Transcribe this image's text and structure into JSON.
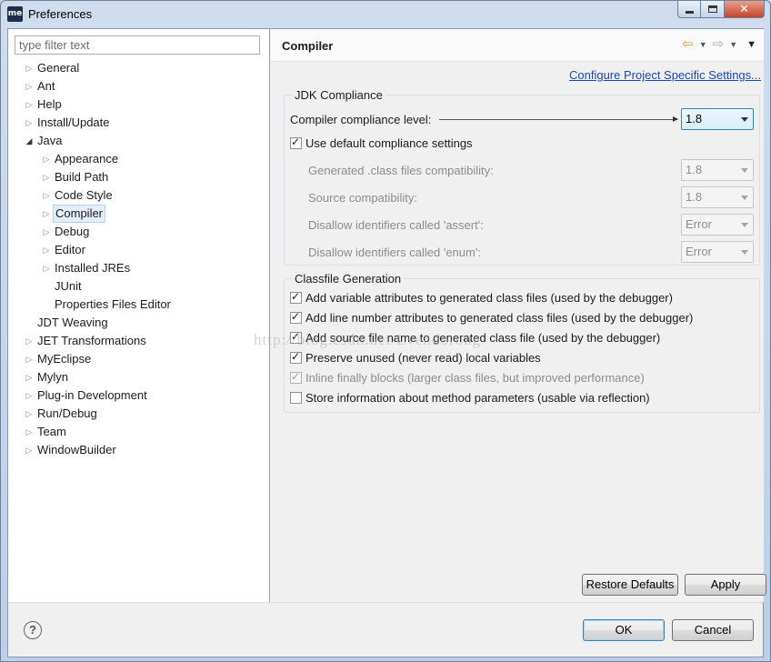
{
  "window": {
    "title": "Preferences",
    "app_icon": "me",
    "controls": {
      "minimize": "minimize-icon",
      "maximize": "maximize-icon",
      "close": "✕"
    }
  },
  "filter": {
    "placeholder": "type filter text",
    "value": ""
  },
  "tree": {
    "items": [
      {
        "label": "General",
        "level": 0,
        "expandable": true,
        "expanded": false
      },
      {
        "label": "Ant",
        "level": 0,
        "expandable": true,
        "expanded": false
      },
      {
        "label": "Help",
        "level": 0,
        "expandable": true,
        "expanded": false
      },
      {
        "label": "Install/Update",
        "level": 0,
        "expandable": true,
        "expanded": false
      },
      {
        "label": "Java",
        "level": 0,
        "expandable": true,
        "expanded": true
      },
      {
        "label": "Appearance",
        "level": 1,
        "expandable": true,
        "expanded": false
      },
      {
        "label": "Build Path",
        "level": 1,
        "expandable": true,
        "expanded": false
      },
      {
        "label": "Code Style",
        "level": 1,
        "expandable": true,
        "expanded": false
      },
      {
        "label": "Compiler",
        "level": 1,
        "expandable": true,
        "expanded": false,
        "selected": true
      },
      {
        "label": "Debug",
        "level": 1,
        "expandable": true,
        "expanded": false
      },
      {
        "label": "Editor",
        "level": 1,
        "expandable": true,
        "expanded": false
      },
      {
        "label": "Installed JREs",
        "level": 1,
        "expandable": true,
        "expanded": false
      },
      {
        "label": "JUnit",
        "level": 1,
        "expandable": false,
        "expanded": false
      },
      {
        "label": "Properties Files Editor",
        "level": 1,
        "expandable": false,
        "expanded": false
      },
      {
        "label": "JDT Weaving",
        "level": 0,
        "expandable": false,
        "expanded": false
      },
      {
        "label": "JET Transformations",
        "level": 0,
        "expandable": true,
        "expanded": false
      },
      {
        "label": "MyEclipse",
        "level": 0,
        "expandable": true,
        "expanded": false
      },
      {
        "label": "Mylyn",
        "level": 0,
        "expandable": true,
        "expanded": false
      },
      {
        "label": "Plug-in Development",
        "level": 0,
        "expandable": true,
        "expanded": false
      },
      {
        "label": "Run/Debug",
        "level": 0,
        "expandable": true,
        "expanded": false
      },
      {
        "label": "Team",
        "level": 0,
        "expandable": true,
        "expanded": false
      },
      {
        "label": "WindowBuilder",
        "level": 0,
        "expandable": true,
        "expanded": false
      }
    ]
  },
  "page": {
    "title": "Compiler",
    "config_link": "Configure Project Specific Settings..."
  },
  "jdk_compliance": {
    "legend": "JDK Compliance",
    "level_label": "Compiler compliance level:",
    "level_value": "1.8",
    "use_default_label": "Use default compliance settings",
    "use_default_checked": true,
    "settings": [
      {
        "label": "Generated .class files compatibility:",
        "value": "1.8"
      },
      {
        "label": "Source compatibility:",
        "value": "1.8"
      },
      {
        "label": "Disallow identifiers called 'assert':",
        "value": "Error"
      },
      {
        "label": "Disallow identifiers called 'enum':",
        "value": "Error"
      }
    ]
  },
  "classfile": {
    "legend": "Classfile Generation",
    "options": [
      {
        "label": "Add variable attributes to generated class files (used by the debugger)",
        "checked": true,
        "disabled": false
      },
      {
        "label": "Add line number attributes to generated class files (used by the debugger)",
        "checked": true,
        "disabled": false
      },
      {
        "label": "Add source file name to generated class file (used by the debugger)",
        "checked": true,
        "disabled": false
      },
      {
        "label": "Preserve unused (never read) local variables",
        "checked": true,
        "disabled": false
      },
      {
        "label": "Inline finally blocks (larger class files, but improved performance)",
        "checked": true,
        "disabled": true
      },
      {
        "label": "Store information about method parameters (usable via reflection)",
        "checked": false,
        "disabled": false
      }
    ]
  },
  "watermark": "http://blog.csdn.net/Lvendorong",
  "buttons": {
    "restore_defaults": "Restore Defaults",
    "apply": "Apply",
    "ok": "OK",
    "cancel": "Cancel"
  },
  "help_icon": "?"
}
